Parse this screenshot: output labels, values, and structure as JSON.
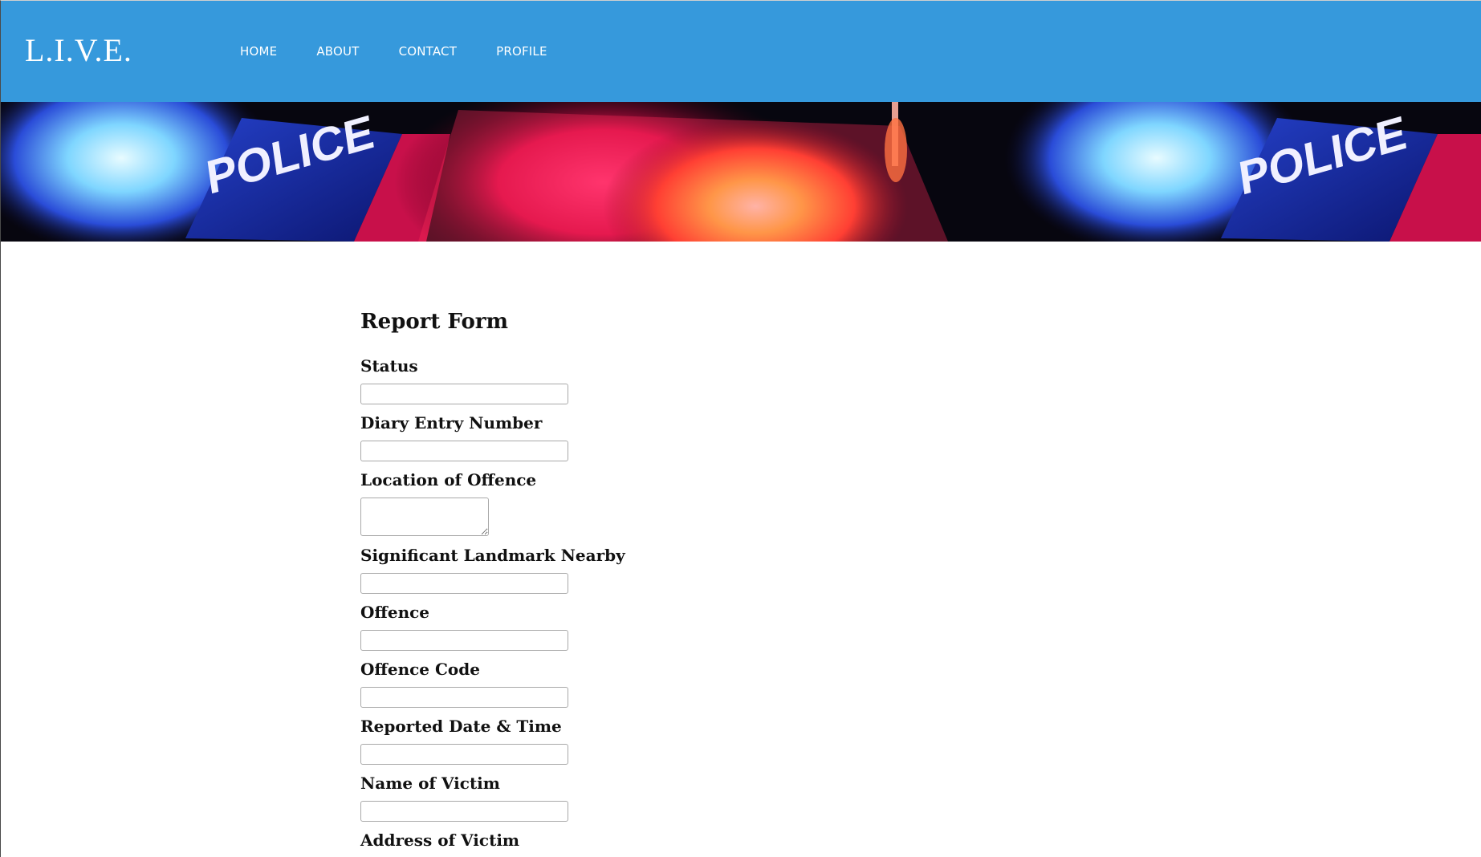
{
  "header": {
    "logo": "L.I.V.E.",
    "nav": [
      "HOME",
      "ABOUT",
      "CONTACT",
      "PROFILE"
    ],
    "background_color": "#3699dc"
  },
  "banner": {
    "text_left": "POLICE",
    "text_right": "POLICE"
  },
  "form": {
    "title": "Report Form",
    "fields": [
      {
        "label": "Status",
        "type": "text",
        "value": ""
      },
      {
        "label": "Diary Entry Number",
        "type": "text",
        "value": ""
      },
      {
        "label": "Location of Offence",
        "type": "textarea",
        "value": ""
      },
      {
        "label": "Significant Landmark Nearby",
        "type": "text",
        "value": ""
      },
      {
        "label": "Offence",
        "type": "text",
        "value": ""
      },
      {
        "label": "Offence Code",
        "type": "text",
        "value": ""
      },
      {
        "label": "Reported Date & Time",
        "type": "text",
        "value": ""
      },
      {
        "label": "Name of Victim",
        "type": "text",
        "value": ""
      },
      {
        "label": "Address of Victim",
        "type": "text",
        "value": ""
      }
    ]
  }
}
